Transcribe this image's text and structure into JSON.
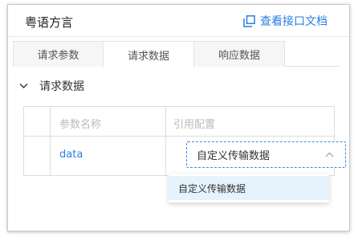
{
  "header": {
    "title": "粤语方言",
    "doc_link": "查看接口文档"
  },
  "tabs": [
    {
      "label": "请求参数",
      "active": false
    },
    {
      "label": "请求数据",
      "active": true
    },
    {
      "label": "响应数据",
      "active": false
    }
  ],
  "section": {
    "title": "请求数据",
    "expanded": true
  },
  "table": {
    "columns": [
      "参数名称",
      "引用配置"
    ],
    "rows": [
      {
        "name": "data",
        "reference": "自定义传输数据"
      }
    ]
  },
  "dropdown": {
    "options": [
      "自定义传输数据"
    ],
    "selected": "自定义传输数据"
  },
  "colors": {
    "accent": "#2a7fe0",
    "option_highlight": "#e6f3fd"
  }
}
